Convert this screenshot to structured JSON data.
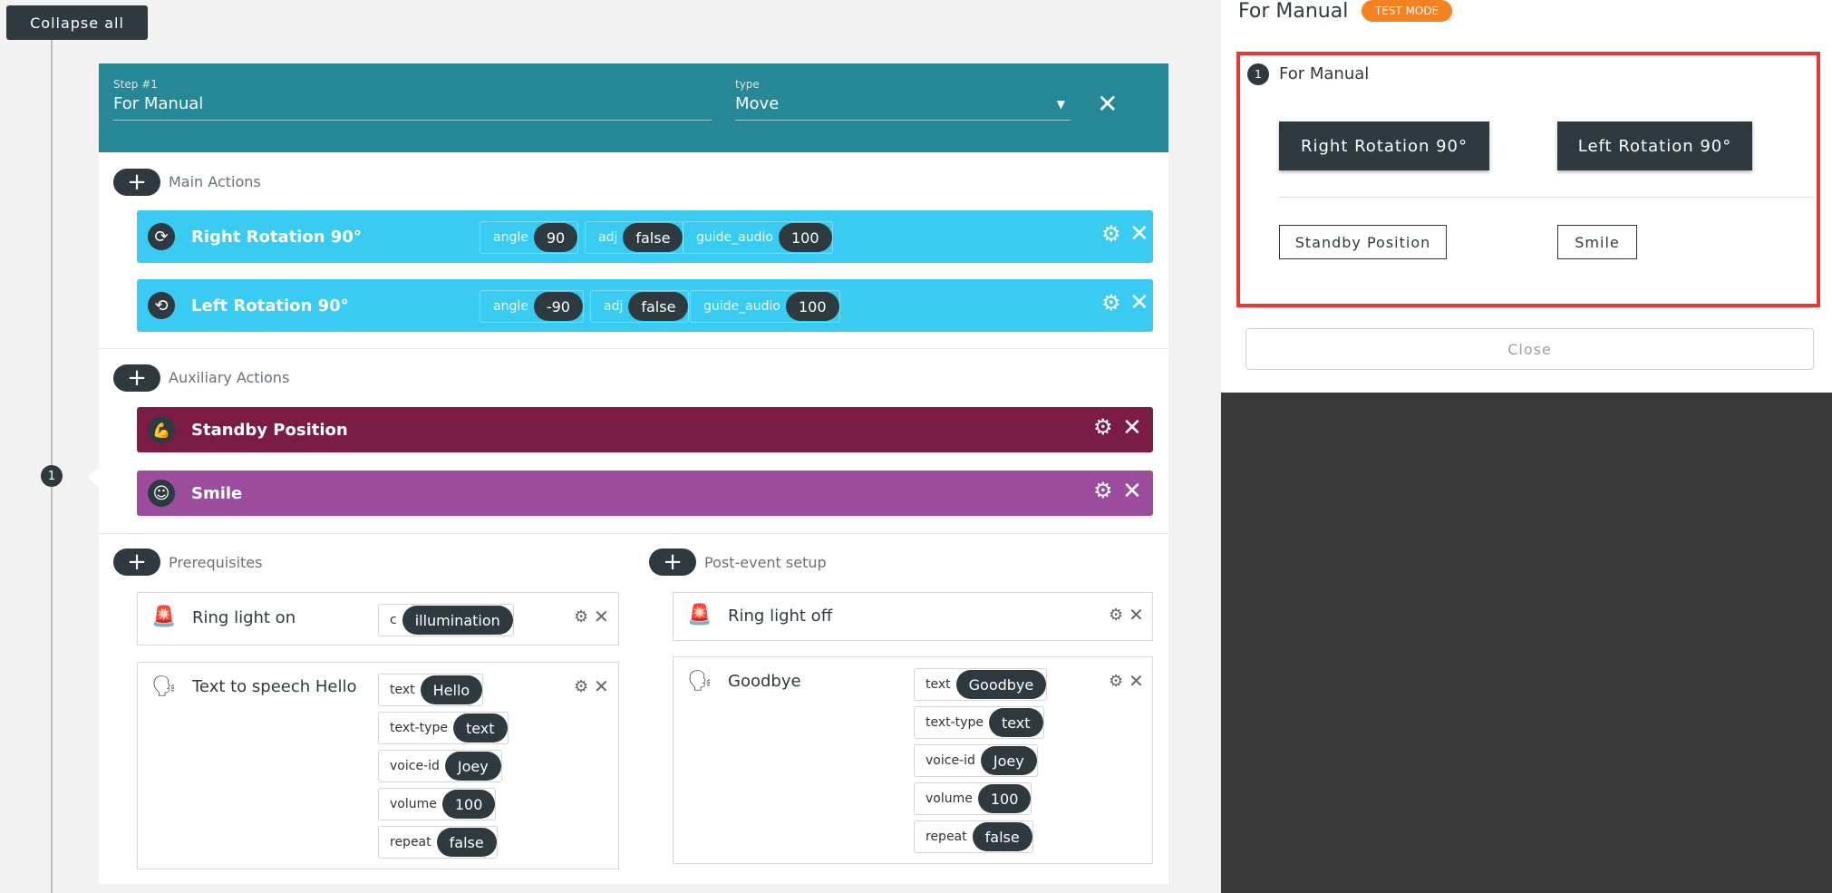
{
  "toolbar": {
    "collapse_all": "Collapse all"
  },
  "step": {
    "number": "1",
    "label": "Step #1",
    "name": "For Manual",
    "type_label": "type",
    "type_value": "Move"
  },
  "main_actions": {
    "label": "Main Actions",
    "items": [
      {
        "title": "Right Rotation 90°",
        "params": [
          {
            "k": "angle",
            "v": "90"
          },
          {
            "k": "adj",
            "v": "false"
          },
          {
            "k": "guide_audio",
            "v": "100"
          }
        ]
      },
      {
        "title": "Left Rotation 90°",
        "params": [
          {
            "k": "angle",
            "v": "-90"
          },
          {
            "k": "adj",
            "v": "false"
          },
          {
            "k": "guide_audio",
            "v": "100"
          }
        ]
      }
    ]
  },
  "auxiliary_actions": {
    "label": "Auxiliary Actions",
    "items": [
      {
        "title": "Standby Position"
      },
      {
        "title": "Smile"
      }
    ]
  },
  "prerequisites": {
    "label": "Prerequisites",
    "items": [
      {
        "title": "Ring light on",
        "params": [
          {
            "k": "c",
            "v": "illumination"
          }
        ]
      },
      {
        "title": "Text to speech Hello",
        "params": [
          {
            "k": "text",
            "v": "Hello"
          },
          {
            "k": "text-type",
            "v": "text"
          },
          {
            "k": "voice-id",
            "v": "Joey"
          },
          {
            "k": "volume",
            "v": "100"
          },
          {
            "k": "repeat",
            "v": "false"
          }
        ]
      }
    ]
  },
  "post_event": {
    "label": "Post-event setup",
    "items": [
      {
        "title": "Ring light off"
      },
      {
        "title": "Goodbye",
        "params": [
          {
            "k": "text",
            "v": "Goodbye"
          },
          {
            "k": "text-type",
            "v": "text"
          },
          {
            "k": "voice-id",
            "v": "Joey"
          },
          {
            "k": "volume",
            "v": "100"
          },
          {
            "k": "repeat",
            "v": "false"
          }
        ]
      }
    ]
  },
  "right_panel": {
    "title": "For Manual",
    "badge": "TEST MODE",
    "step_number": "1",
    "step_name": "For Manual",
    "main_buttons": [
      "Right Rotation 90°",
      "Left Rotation 90°"
    ],
    "aux_buttons": [
      "Standby Position",
      "Smile"
    ],
    "close": "Close"
  },
  "colors": {
    "header_teal": "#268796",
    "main_action": "#39cbf1",
    "standby": "#7b1c44",
    "smile": "#9b4c9c",
    "badge": "#f58220",
    "highlight": "#e53935"
  }
}
